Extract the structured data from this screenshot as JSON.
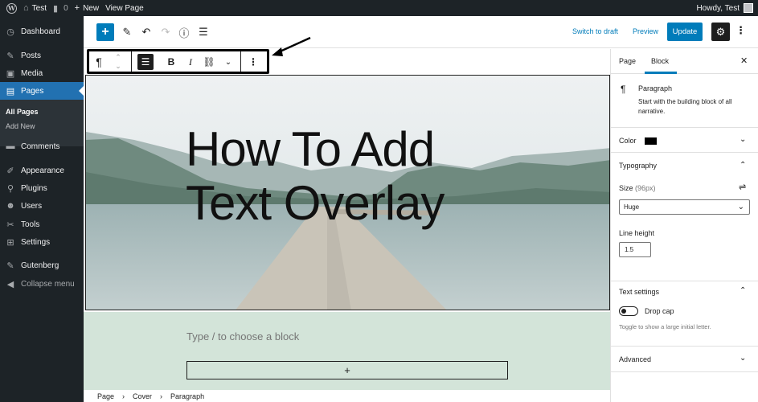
{
  "admin_bar": {
    "site_name": "Test",
    "comments_count": "0",
    "new_label": "New",
    "view_page_label": "View Page",
    "howdy": "Howdy, Test"
  },
  "sidebar": {
    "items": [
      {
        "label": "Dashboard",
        "icon": "dashboard-icon"
      },
      {
        "label": "Posts",
        "icon": "pushpin-icon"
      },
      {
        "label": "Media",
        "icon": "media-icon"
      },
      {
        "label": "Pages",
        "icon": "pages-icon",
        "active": true
      },
      {
        "label": "Comments",
        "icon": "comment-icon"
      },
      {
        "label": "Appearance",
        "icon": "brush-icon"
      },
      {
        "label": "Plugins",
        "icon": "plugin-icon"
      },
      {
        "label": "Users",
        "icon": "users-icon"
      },
      {
        "label": "Tools",
        "icon": "wrench-icon"
      },
      {
        "label": "Settings",
        "icon": "settings-icon"
      },
      {
        "label": "Gutenberg",
        "icon": "gutenberg-icon"
      },
      {
        "label": "Collapse menu",
        "icon": "collapse-icon"
      }
    ],
    "submenu": [
      "All Pages",
      "Add New"
    ]
  },
  "editor_toolbar": {
    "switch_to_draft": "Switch to draft",
    "preview": "Preview",
    "update": "Update"
  },
  "cover": {
    "heading_line1": "How To Add",
    "heading_line2": "Text Overlay"
  },
  "block_toolbar": {
    "paragraph_glyph": "¶",
    "bold": "B",
    "italic": "I"
  },
  "appender": {
    "placeholder": "Type / to choose a block",
    "plus": "+"
  },
  "breadcrumb": [
    "Page",
    "Cover",
    "Paragraph"
  ],
  "panel": {
    "tabs": [
      "Page",
      "Block"
    ],
    "active_tab": "Block",
    "block_name": "Paragraph",
    "block_description": "Start with the building block of all narrative.",
    "color_label": "Color",
    "color_value": "#000000",
    "typography_title": "Typography",
    "size_label": "Size",
    "size_value": "(96px)",
    "size_select": "Huge",
    "line_height_label": "Line height",
    "line_height_value": "1.5",
    "text_settings_title": "Text settings",
    "drop_cap_label": "Drop cap",
    "drop_cap_help": "Toggle to show a large initial letter.",
    "advanced_title": "Advanced"
  },
  "colors": {
    "admin_dark": "#1d2327",
    "accent_blue": "#007cba",
    "menu_active": "#2271b1",
    "appender_bg": "#d3e4d9"
  }
}
